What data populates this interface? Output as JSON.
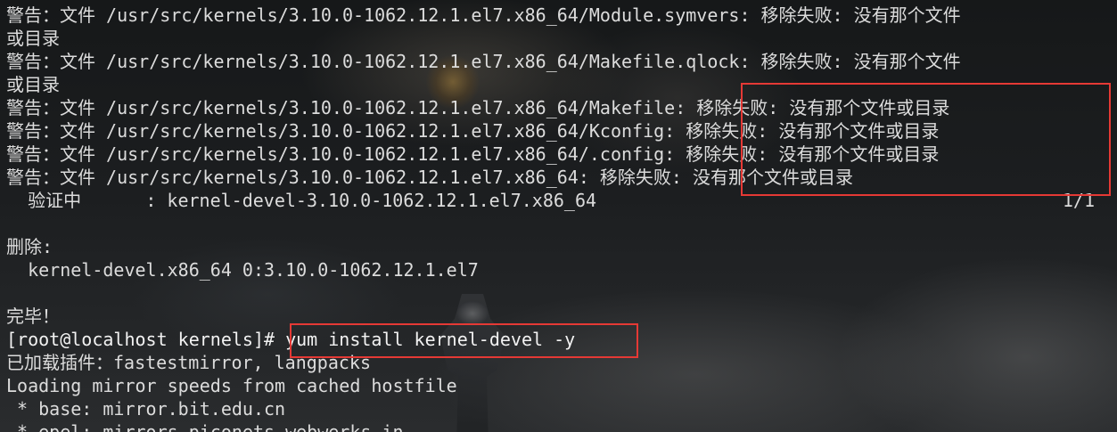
{
  "terminal": {
    "lines": [
      "警告：文件 /usr/src/kernels/3.10.0-1062.12.1.el7.x86_64/Module.symvers: 移除失败: 没有那个文件",
      "或目录",
      "警告：文件 /usr/src/kernels/3.10.0-1062.12.1.el7.x86_64/Makefile.qlock: 移除失败: 没有那个文件",
      "或目录",
      "警告：文件 /usr/src/kernels/3.10.0-1062.12.1.el7.x86_64/Makefile: 移除失败: 没有那个文件或目录",
      "警告：文件 /usr/src/kernels/3.10.0-1062.12.1.el7.x86_64/Kconfig: 移除失败: 没有那个文件或目录",
      "警告：文件 /usr/src/kernels/3.10.0-1062.12.1.el7.x86_64/.config: 移除失败: 没有那个文件或目录",
      "警告：文件 /usr/src/kernels/3.10.0-1062.12.1.el7.x86_64: 移除失败: 没有那个文件或目录",
      "  验证中      : kernel-devel-3.10.0-1062.12.1.el7.x86_64",
      "",
      "删除:",
      "  kernel-devel.x86_64 0:3.10.0-1062.12.1.el7",
      "",
      "完毕！",
      "[root@localhost kernels]# yum install kernel-devel -y",
      "已加载插件：fastestmirror, langpacks",
      "Loading mirror speeds from cached hostfile",
      " * base: mirror.bit.edu.cn",
      " * epel: mirrors.piconets.webwerks.in"
    ],
    "progress_count": "1/1"
  },
  "annotations": {
    "box_color": "#e53935"
  },
  "colors": {
    "text": "#dcdcdc",
    "background": "#151719"
  }
}
